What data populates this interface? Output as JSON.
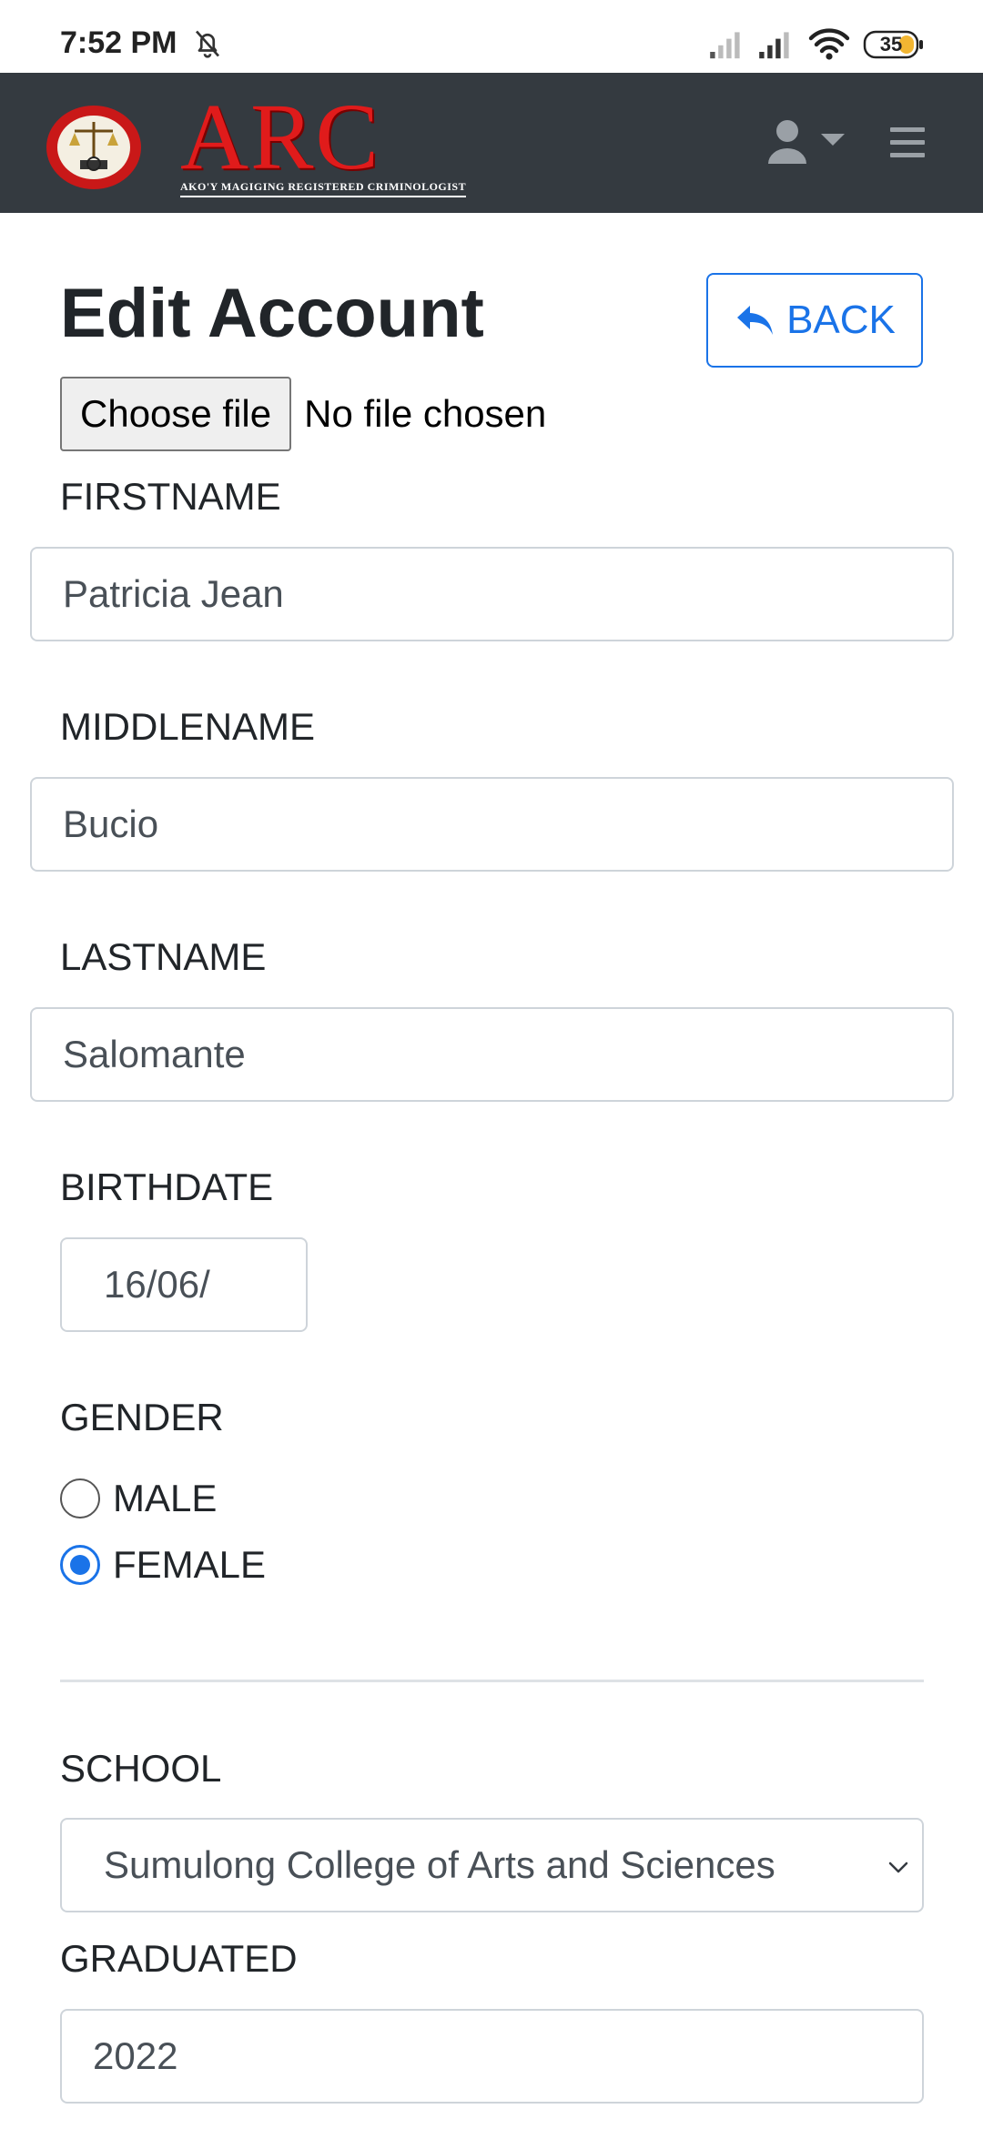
{
  "status_bar": {
    "time": "7:52 PM",
    "battery": "35",
    "icons": [
      "bell-off-icon",
      "signal-icon",
      "signal-icon",
      "wifi-icon",
      "battery-icon"
    ]
  },
  "navbar": {
    "logo_text": "ARC",
    "logo_tagline": "AKO'Y MAGIGING REGISTERED CRIMINOLOGIST",
    "icons": [
      "user-icon",
      "caret-down-icon",
      "menu-icon"
    ]
  },
  "page": {
    "title": "Edit Account",
    "back_label": "BACK"
  },
  "file_input": {
    "button_label": "Choose file",
    "status": "No file chosen"
  },
  "form": {
    "firstname_label": "FIRSTNAME",
    "firstname_value": "Patricia Jean",
    "middlename_label": "MIDDLENAME",
    "middlename_value": "Bucio",
    "lastname_label": "LASTNAME",
    "lastname_value": "Salomante",
    "birthdate_label": "BIRTHDATE",
    "birthdate_value": "16/06/",
    "gender_label": "GENDER",
    "gender_options": [
      {
        "label": "MALE",
        "checked": false
      },
      {
        "label": "FEMALE",
        "checked": true
      }
    ],
    "school_label": "SCHOOL",
    "school_value": "Sumulong College of Arts and Sciences",
    "graduated_label": "GRADUATED",
    "graduated_value": "2022"
  },
  "colors": {
    "navbar": "#343a40",
    "accent": "#1a73e8",
    "logo_red": "#e01b1b"
  }
}
